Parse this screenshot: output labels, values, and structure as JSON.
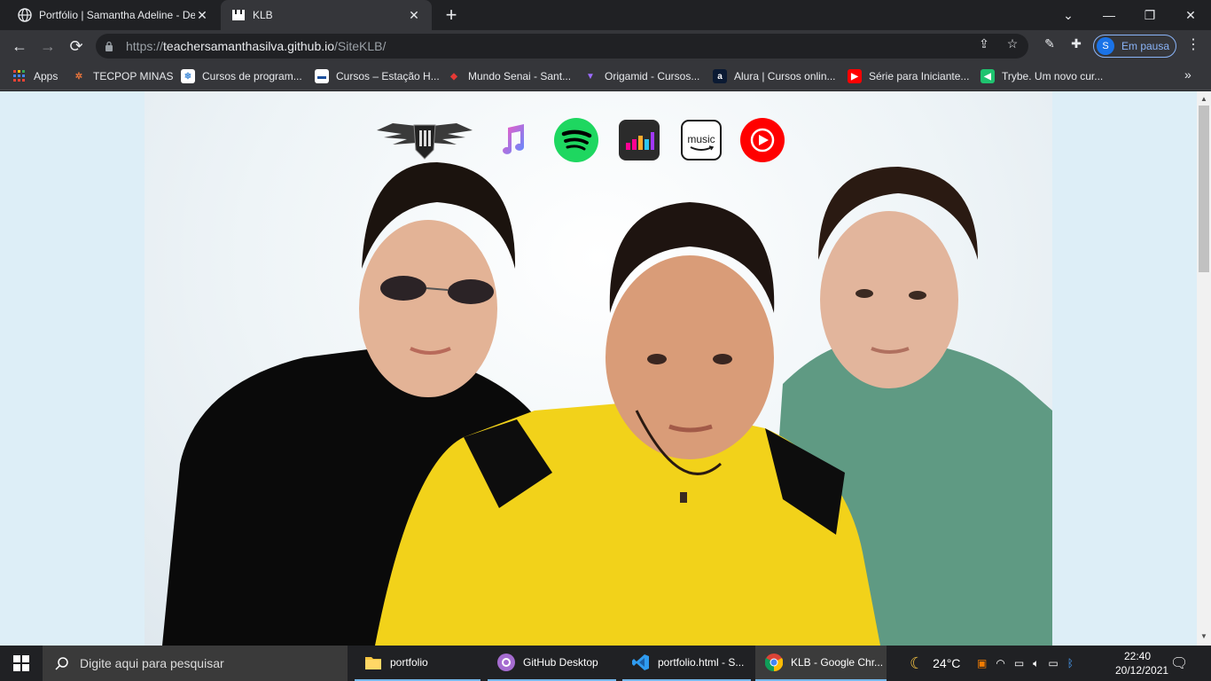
{
  "browser": {
    "tabs": [
      {
        "title": "Portfólio | Samantha Adeline - De",
        "active": false
      },
      {
        "title": "KLB",
        "active": true
      }
    ],
    "url_host": "teachersamanthasilva.github.io",
    "url_prefix": "https://",
    "url_path": "/SiteKLB/",
    "profile_initial": "S",
    "profile_status": "Em pausa"
  },
  "bookmarks": [
    {
      "label": "Apps",
      "icon": "apps-grid-icon",
      "color": "#ea4335"
    },
    {
      "label": "TECPOP MINAS",
      "icon": "tecpop-icon",
      "color": "#e8743b"
    },
    {
      "label": "Cursos de program...",
      "icon": "snowflake-icon",
      "color": "#4a90d9"
    },
    {
      "label": "Cursos – Estação H...",
      "icon": "estacao-icon",
      "color": "#ffffff"
    },
    {
      "label": "Mundo Senai - Sant...",
      "icon": "senai-icon",
      "color": "#e53935"
    },
    {
      "label": "Origamid - Cursos...",
      "icon": "origamid-icon",
      "color": "#7c4dff"
    },
    {
      "label": "Alura | Cursos onlin...",
      "icon": "alura-icon",
      "color": "#0b1a33"
    },
    {
      "label": "Série para Iniciante...",
      "icon": "youtube-icon",
      "color": "#ff0000"
    },
    {
      "label": "Trybe. Um novo cur...",
      "icon": "trybe-icon",
      "color": "#1fc36f"
    }
  ],
  "page": {
    "services": [
      {
        "name": "klb-logo",
        "color": "#ffffff"
      },
      {
        "name": "apple-music",
        "color": "#fa57c1"
      },
      {
        "name": "spotify",
        "color": "#1ed760"
      },
      {
        "name": "deezer",
        "color": "#2b2b2b"
      },
      {
        "name": "amazon-music",
        "color": "#ffffff"
      },
      {
        "name": "youtube-music",
        "color": "#ff0000"
      }
    ],
    "music_label": "music"
  },
  "taskbar": {
    "search_placeholder": "Digite aqui para pesquisar",
    "apps": [
      {
        "label": "portfolio",
        "icon": "folder-icon"
      },
      {
        "label": "GitHub Desktop",
        "icon": "github-icon"
      },
      {
        "label": "portfolio.html - S...",
        "icon": "vscode-icon"
      },
      {
        "label": "KLB - Google Chr...",
        "icon": "chrome-icon"
      }
    ],
    "weather": "24°C",
    "time": "22:40",
    "date": "20/12/2021"
  }
}
